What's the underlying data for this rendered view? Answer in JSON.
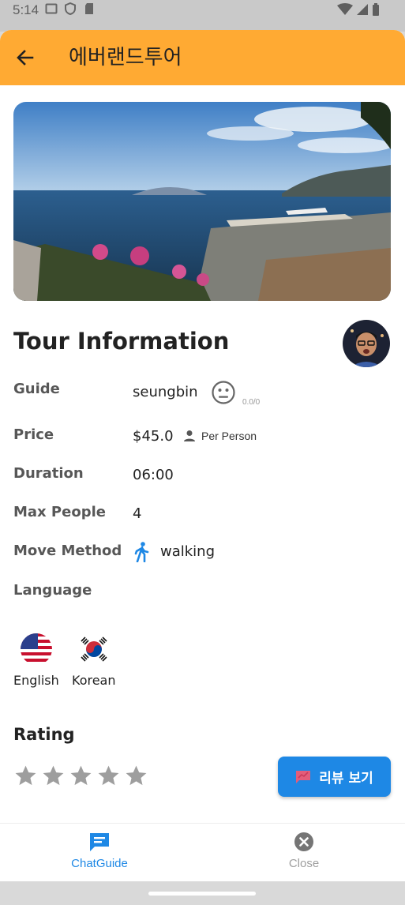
{
  "status_bar": {
    "time": "5:14"
  },
  "app_bar": {
    "title": "에버랜드투어"
  },
  "tour": {
    "section_title": "Tour Information",
    "rows": {
      "guide": {
        "label": "Guide",
        "value": "seungbin",
        "score": "0.0/0"
      },
      "price": {
        "label": "Price",
        "value": "$45.0",
        "unit": "Per Person"
      },
      "duration": {
        "label": "Duration",
        "value": "06:00"
      },
      "max_people": {
        "label": "Max People",
        "value": "4"
      },
      "move_method": {
        "label": "Move Method",
        "value": "walking"
      },
      "language": {
        "label": "Language"
      }
    },
    "languages": [
      {
        "name": "English"
      },
      {
        "name": "Korean"
      }
    ]
  },
  "rating": {
    "title": "Rating",
    "stars_filled": 0,
    "stars_total": 5
  },
  "review_button": {
    "label": "리뷰 보기"
  },
  "bottom_nav": {
    "chat": {
      "label": "ChatGuide"
    },
    "close": {
      "label": "Close"
    }
  },
  "colors": {
    "app_bar": "#FFAA33",
    "primary": "#1E88E5",
    "star_empty": "#9E9E9E"
  }
}
